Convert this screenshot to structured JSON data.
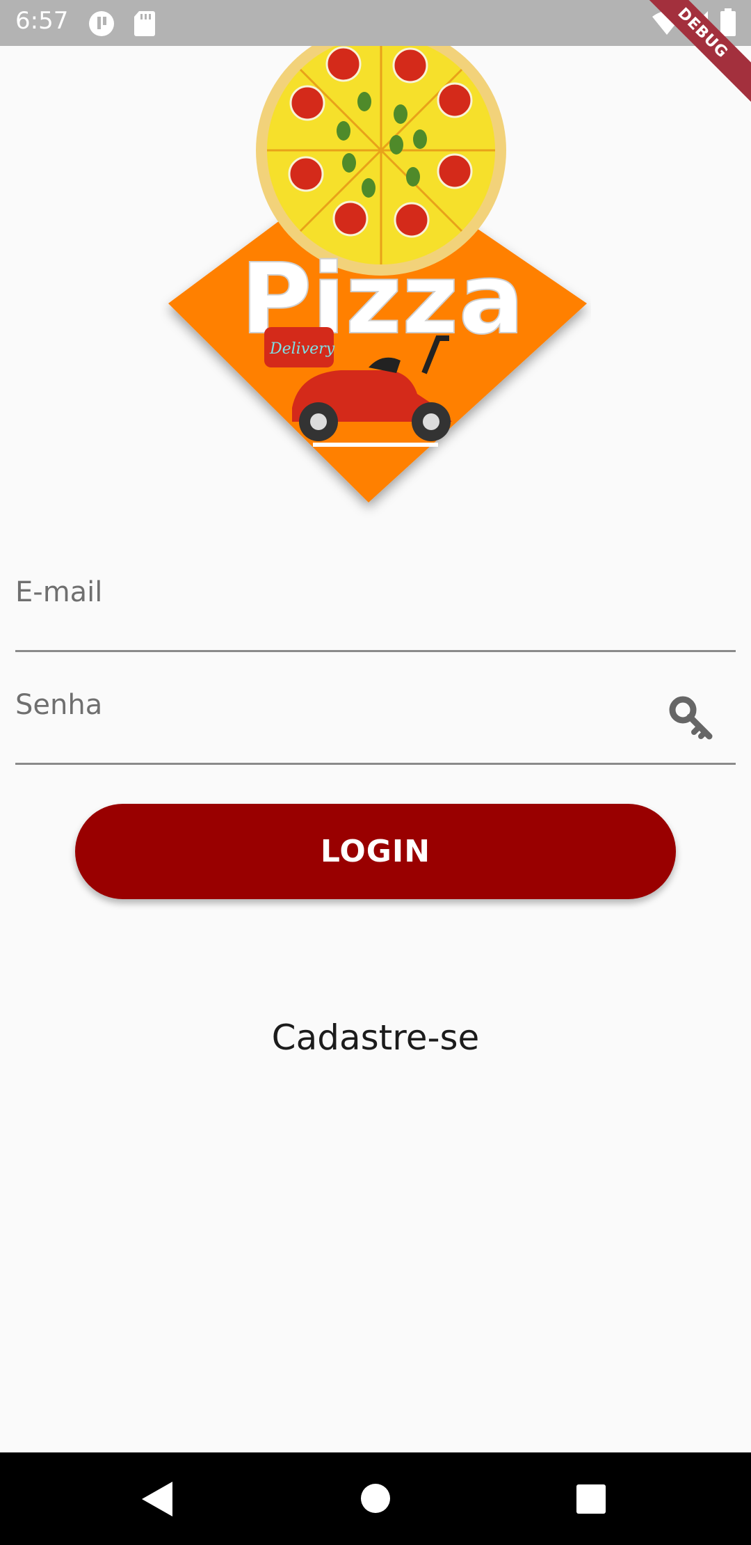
{
  "status_bar": {
    "time": "6:57",
    "icons": [
      "notification-icon",
      "sd-card-icon",
      "wifi-icon",
      "cell-signal-icon",
      "battery-icon"
    ],
    "debug_label": "DEBUG"
  },
  "logo": {
    "title": "Pizza",
    "badge": "Delivery",
    "colors": {
      "diamond": "#ff8000",
      "crust": "#f2d27a",
      "cheese": "#f6e02b",
      "pepperoni": "#d42a1a",
      "olive": "#4f8a2a",
      "scooter": "#d42a1a"
    }
  },
  "form": {
    "email_label": "E-mail",
    "password_label": "Senha",
    "login_label": "LOGIN",
    "signup_label": "Cadastre-se"
  },
  "nav_bar": {
    "buttons": [
      "back-icon",
      "home-icon",
      "recents-icon"
    ]
  },
  "colors": {
    "accent": "#990000",
    "background": "#fafafa",
    "status_bar": "#b3b3b3"
  }
}
